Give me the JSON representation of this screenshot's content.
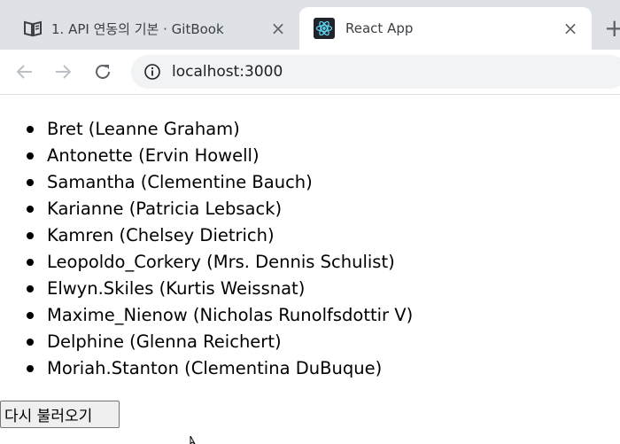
{
  "browser": {
    "tabs": [
      {
        "title": "1. API 연동의 기본 · GitBook",
        "favicon": "book-icon",
        "active": false
      },
      {
        "title": "React App",
        "favicon": "react-icon",
        "active": true
      }
    ],
    "new_tab_label": "+",
    "close_label": "×",
    "address": "localhost:3000"
  },
  "page": {
    "users": [
      {
        "text": "Bret (Leanne Graham)"
      },
      {
        "text": "Antonette (Ervin Howell)"
      },
      {
        "text": "Samantha (Clementine Bauch)"
      },
      {
        "text": "Karianne (Patricia Lebsack)"
      },
      {
        "text": "Kamren (Chelsey Dietrich)"
      },
      {
        "text": "Leopoldo_Corkery (Mrs. Dennis Schulist)"
      },
      {
        "text": "Elwyn.Skiles (Kurtis Weissnat)"
      },
      {
        "text": "Maxime_Nienow (Nicholas Runolfsdottir V)"
      },
      {
        "text": "Delphine (Glenna Reichert)"
      },
      {
        "text": "Moriah.Stanton (Clementina DuBuque)"
      }
    ],
    "reload_button": "다시 불러오기"
  },
  "colors": {
    "tab_strip": "#dee1e6",
    "active_tab": "#ffffff",
    "omnibox": "#f1f3f4",
    "react_blue": "#61dafb"
  }
}
